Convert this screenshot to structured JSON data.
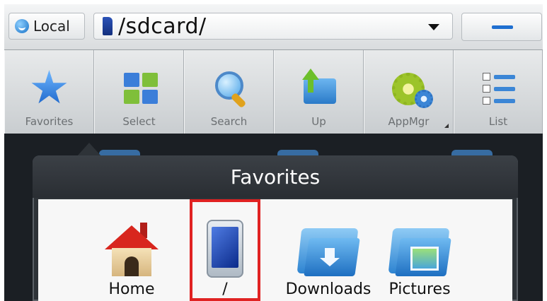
{
  "topbar": {
    "local_label": "Local",
    "path": "/sdcard/"
  },
  "toolbar": {
    "items": [
      {
        "label": "Favorites",
        "icon": "star-icon"
      },
      {
        "label": "Select",
        "icon": "select-grid-icon"
      },
      {
        "label": "Search",
        "icon": "search-icon"
      },
      {
        "label": "Up",
        "icon": "folder-up-icon"
      },
      {
        "label": "AppMgr",
        "icon": "gears-icon"
      },
      {
        "label": "List",
        "icon": "list-view-icon"
      }
    ]
  },
  "favorites_popup": {
    "title": "Favorites",
    "items": [
      {
        "label": "Home",
        "icon": "home-icon"
      },
      {
        "label": "/",
        "icon": "phone-icon",
        "selected": true
      },
      {
        "label": "Downloads",
        "icon": "downloads-folder-icon"
      },
      {
        "label": "Pictures",
        "icon": "pictures-folder-icon"
      }
    ]
  },
  "colors": {
    "selection_outline": "#e02222",
    "popup_title_bg": "#2e3338",
    "accent_blue": "#1f6fd0"
  }
}
